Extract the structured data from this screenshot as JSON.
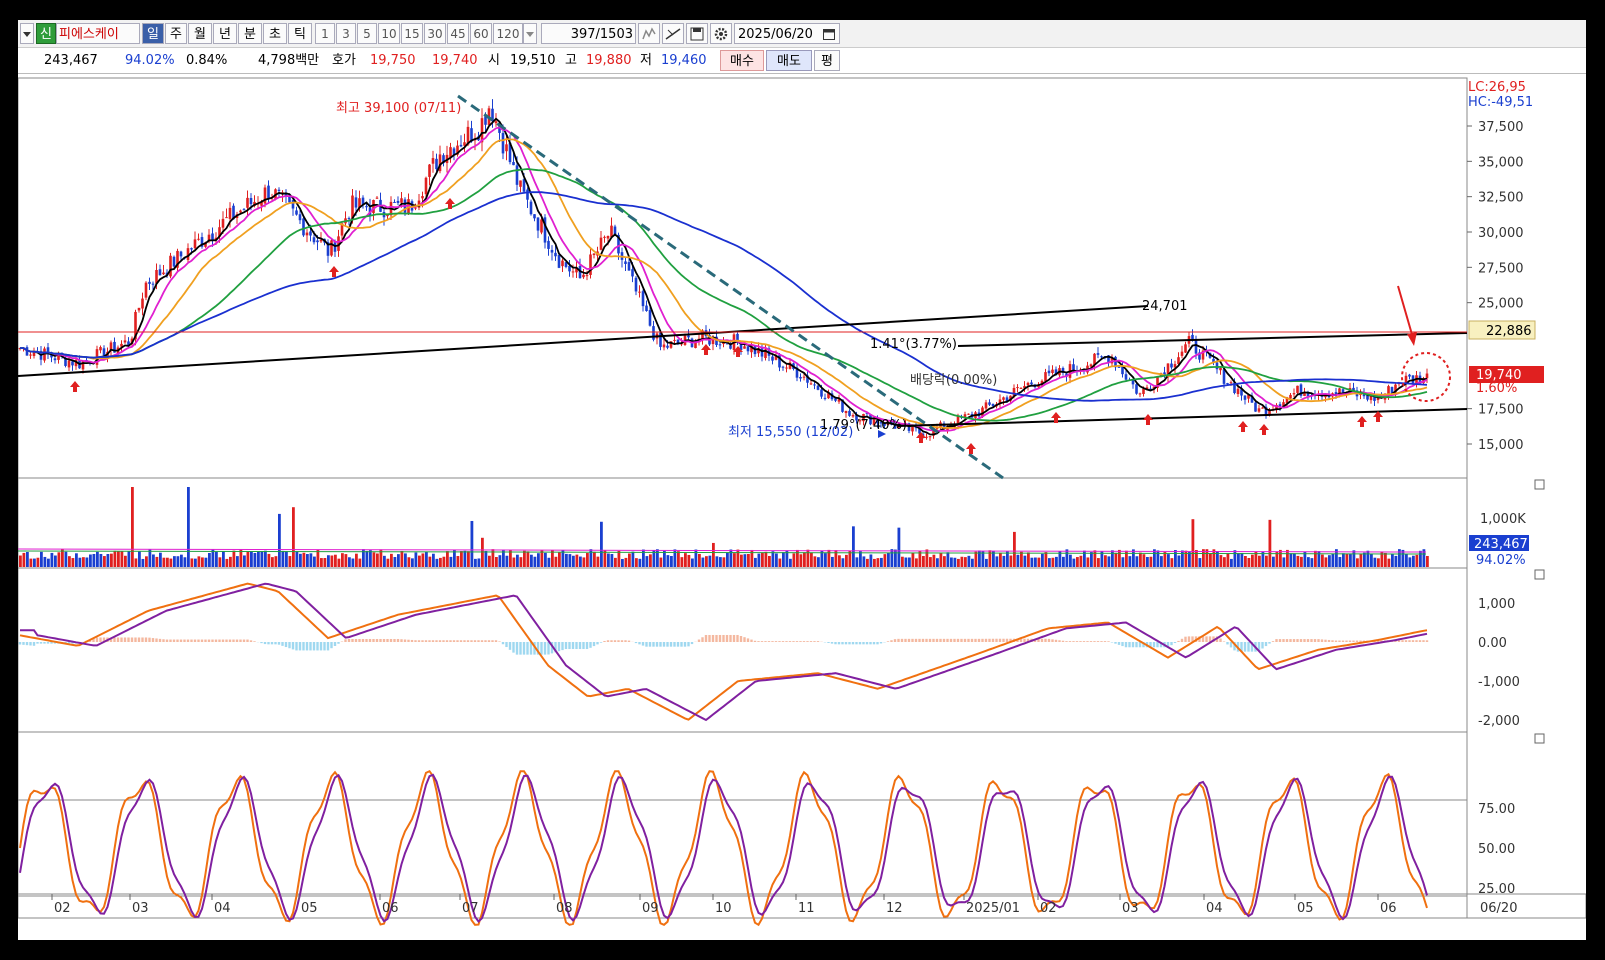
{
  "toolbar": {
    "dropdown_icon": "chevron-down-icon",
    "new_badge": "신",
    "stock_name": "피에스케이",
    "periods": [
      "일",
      "주",
      "월",
      "년",
      "분",
      "초",
      "틱"
    ],
    "active_period": "일",
    "intervals": [
      "1",
      "3",
      "5",
      "10",
      "15",
      "30",
      "45",
      "60",
      "120"
    ],
    "count": "397",
    "total": "/1503",
    "date": "2025/06/20",
    "icons": [
      "tick-chart-icon",
      "line-tool-icon",
      "save-icon",
      "gear-icon",
      "calendar-icon"
    ]
  },
  "quote": {
    "volume": "243,467",
    "vol_pct": "94.02%",
    "change_pct": "0.84%",
    "amount": "4,798백만",
    "hoga_label": "호가",
    "ask": "19,750",
    "bid": "19,740",
    "open_label": "시",
    "open": "19,510",
    "high_label": "고",
    "high": "19,880",
    "low_label": "저",
    "low": "19,460",
    "buy_label": "매수",
    "sell_label": "매도",
    "avg_label": "평"
  },
  "price_panel": {
    "lc": "LC:26,95",
    "hc": "HC:-49,51",
    "y_ticks": [
      "37,500",
      "35,000",
      "32,500",
      "30,000",
      "27,500",
      "25,000",
      "17,500",
      "15,000"
    ],
    "high_note": "최고 39,100 (07/11)",
    "low_note": "최저 15,550 (12/02)",
    "trend_value": "24,701",
    "ref_price": "22,886",
    "current_price": "19,740",
    "current_pct": "1.60%",
    "note_1": "1.41°(3.77%)",
    "note_2": "배당락(0.00%)",
    "note_3": "1.79°(7.40%)"
  },
  "volume_panel": {
    "tick": "1,000K",
    "value": "243,467",
    "pct": "94.02%"
  },
  "macd_panel": {
    "ticks": [
      "1,000",
      "0.00",
      "-1,000",
      "-2,000"
    ]
  },
  "stoch_panel": {
    "ticks": [
      "75.00",
      "50.00",
      "25.00"
    ]
  },
  "x_axis": {
    "labels": [
      "02",
      "03",
      "04",
      "05",
      "06",
      "07",
      "08",
      "09",
      "10",
      "11",
      "12",
      "2025/01",
      "02",
      "03",
      "04",
      "05",
      "06"
    ],
    "end_label": "06/20"
  },
  "colors": {
    "up": "#e02020",
    "down": "#1a3fd0",
    "ma5": "#000000",
    "ma10": "#e020d0",
    "ma20": "#f0a020",
    "ma60": "#20a040",
    "ma120": "#1a30d0",
    "macd": "#f07010",
    "signal": "#8020a0"
  }
}
